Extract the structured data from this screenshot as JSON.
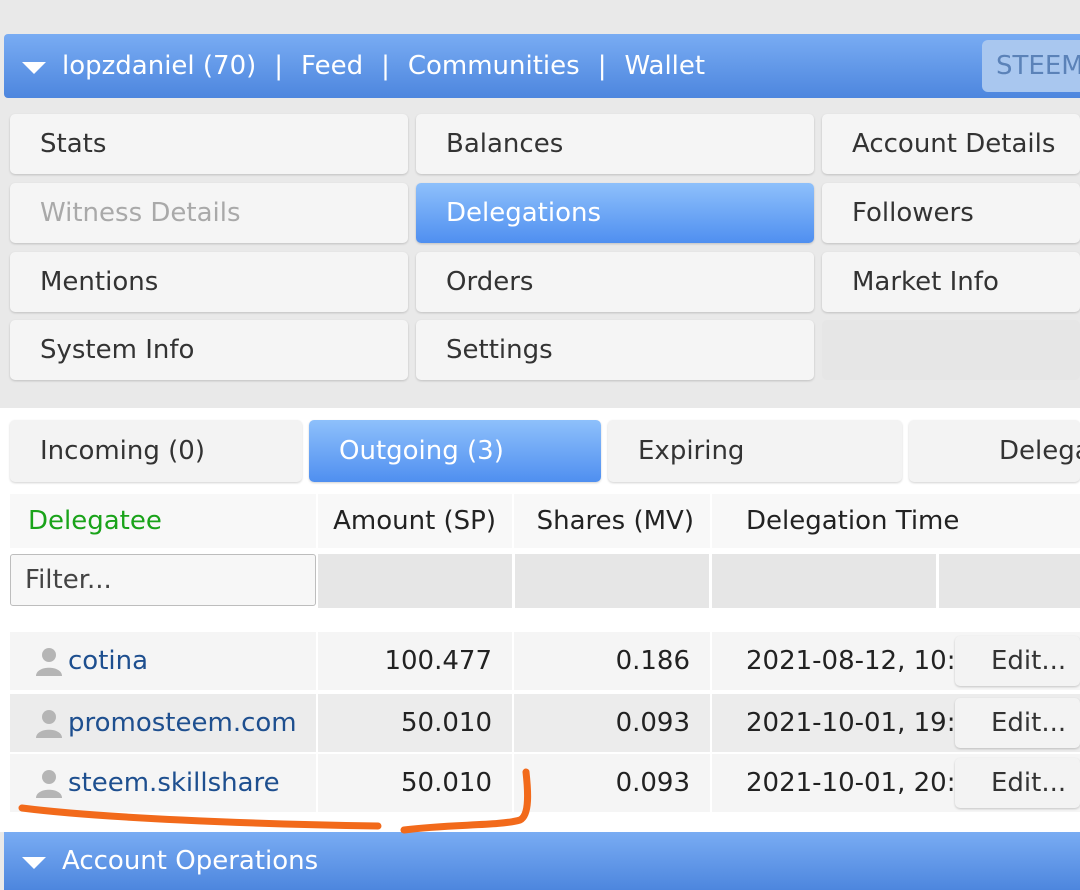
{
  "header": {
    "user": "lopzdaniel (70)",
    "sep": "|",
    "links": [
      "Feed",
      "Communities",
      "Wallet"
    ],
    "steem_button": "STEEM"
  },
  "menu": {
    "stats": "Stats",
    "balances": "Balances",
    "account_details": "Account Details",
    "witness_details": "Witness Details",
    "delegations": "Delegations",
    "followers": "Followers",
    "mentions": "Mentions",
    "orders": "Orders",
    "market_info": "Market Info",
    "system_info": "System Info",
    "settings": "Settings"
  },
  "tabs": {
    "incoming": "Incoming (0)",
    "outgoing": "Outgoing (3)",
    "expiring": "Expiring",
    "delegate": "Delega"
  },
  "table": {
    "headers": {
      "delegatee": "Delegatee",
      "amount": "Amount (SP)",
      "shares": "Shares (MV)",
      "time": "Delegation Time"
    },
    "filter_placeholder": "Filter...",
    "edit_label": "Edit...",
    "rows": [
      {
        "name": "cotina",
        "amount": "100.477",
        "shares": "0.186",
        "time": "2021-08-12, 10:"
      },
      {
        "name": "promosteem.com",
        "amount": "50.010",
        "shares": "0.093",
        "time": "2021-10-01, 19:"
      },
      {
        "name": "steem.skillshare",
        "amount": "50.010",
        "shares": "0.093",
        "time": "2021-10-01, 20:"
      }
    ]
  },
  "footer": {
    "title": "Account Operations"
  },
  "colors": {
    "accent_blue": "#4d86de",
    "header_green": "#1aa31a",
    "link_blue": "#1e4f8f",
    "annotation_orange": "#f26a1b"
  }
}
